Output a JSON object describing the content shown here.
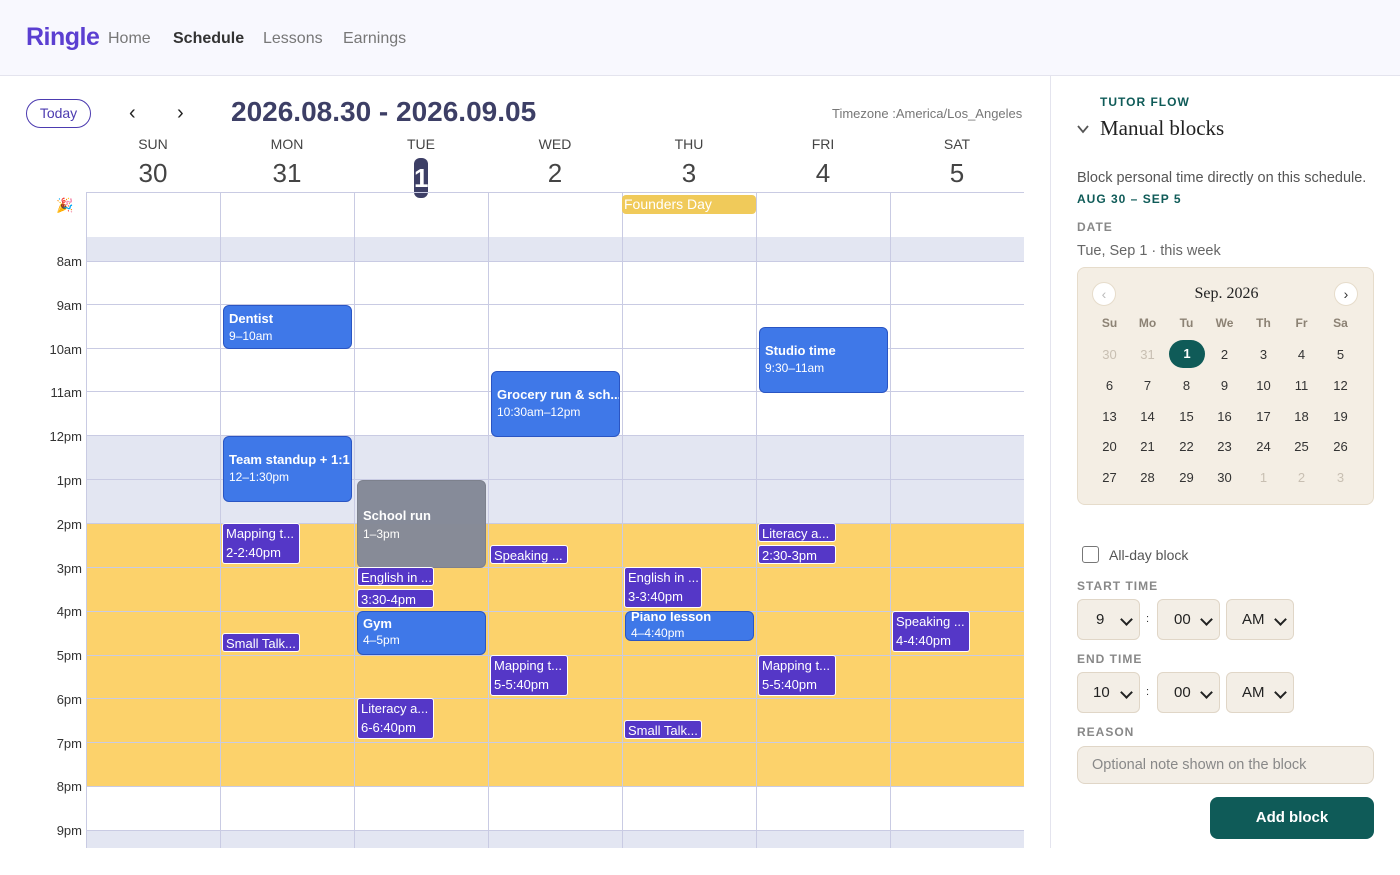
{
  "app": {
    "logo": "Ringle"
  },
  "nav": [
    "Home",
    "Schedule",
    "Lessons",
    "Earnings"
  ],
  "toolbar": {
    "today": "Today",
    "prev": "‹",
    "next": "›",
    "range": "2026.08.30 - 2026.09.05",
    "timezone": "Timezone :America/Los_Angeles"
  },
  "days": [
    {
      "name": "SUN",
      "date": "30"
    },
    {
      "name": "MON",
      "date": "31"
    },
    {
      "name": "TUE",
      "date": "1",
      "selected": true
    },
    {
      "name": "WED",
      "date": "2"
    },
    {
      "name": "THU",
      "date": "3"
    },
    {
      "name": "FRI",
      "date": "4"
    },
    {
      "name": "SAT",
      "date": "5"
    }
  ],
  "all_day_icon": "🎉",
  "all_day_event": "Founders Day",
  "hours": [
    "8am",
    "9am",
    "10am",
    "11am",
    "12pm",
    "1pm",
    "2pm",
    "3pm",
    "4pm",
    "5pm",
    "6pm",
    "7pm",
    "8pm",
    "9pm"
  ],
  "events": [
    {
      "title": "Dentist",
      "time": "9–10am"
    },
    {
      "title": "Team standup + 1:1",
      "time": "12–1:30pm"
    },
    {
      "title": "Studio time",
      "time": "9:30–11am"
    },
    {
      "title": "Grocery run & sch...",
      "time": "10:30am–12pm"
    },
    {
      "title": "School run",
      "time": "1–3pm"
    },
    {
      "title": "Gym",
      "time": "4–5pm"
    },
    {
      "title": "Piano lesson",
      "time": "4–4:40pm"
    }
  ],
  "slots": [
    {
      "title": "Mapping t...",
      "time": "2-2:40pm"
    },
    {
      "title": "Small Talk..."
    },
    {
      "title": "English in ...",
      "time": "3:30-4pm"
    },
    {
      "title": "Literacy a...",
      "time": "6-6:40pm"
    },
    {
      "title": "Speaking ..."
    },
    {
      "title": "Mapping t...",
      "time": "5-5:40pm"
    },
    {
      "title": "English in ...",
      "time": "3-3:40pm"
    },
    {
      "title": "Small Talk..."
    },
    {
      "title": "Literacy a...",
      "time": "2:30-3pm"
    },
    {
      "title": "Mapping t...",
      "time": "5-5:40pm"
    },
    {
      "title": "Speaking ...",
      "time": "4-4:40pm"
    }
  ],
  "colors": {
    "accent": "#5b3fd1",
    "teal": "#0f5b58",
    "event_blue": "#3f78e8",
    "slot_purple": "#5537c7",
    "open_hours": "#fcd26b",
    "blocked": "#e3e6f2",
    "holiday": "#f0ca5a"
  },
  "sidebar": {
    "flow_label": "TUTOR FLOW",
    "chevron_icon": "chevron-down-icon",
    "title": "Manual blocks",
    "description": "Block personal time directly on this schedule.",
    "range": "AUG 30 – SEP 5",
    "date_label": "DATE",
    "date_value": "Tue, Sep 1 · this week",
    "calendar": {
      "month": "Sep. 2026",
      "prev": "‹",
      "next": "›",
      "weekdays": [
        "Su",
        "Mo",
        "Tu",
        "We",
        "Th",
        "Fr",
        "Sa"
      ],
      "weeks": [
        [
          "30",
          "31",
          "1",
          "2",
          "3",
          "4",
          "5"
        ],
        [
          "6",
          "7",
          "8",
          "9",
          "10",
          "11",
          "12"
        ],
        [
          "13",
          "14",
          "15",
          "16",
          "17",
          "18",
          "19"
        ],
        [
          "20",
          "21",
          "22",
          "23",
          "24",
          "25",
          "26"
        ],
        [
          "27",
          "28",
          "29",
          "30",
          "1",
          "2",
          "3"
        ]
      ],
      "selected": "1"
    },
    "all_day_label": "All-day block",
    "start_label": "START TIME",
    "start": {
      "hour": "9",
      "minute": "00",
      "ampm": "AM"
    },
    "end_label": "END TIME",
    "end": {
      "hour": "10",
      "minute": "00",
      "ampm": "AM"
    },
    "colon": ":",
    "reason_label": "REASON",
    "reason_placeholder": "Optional note shown on the block",
    "add_button": "Add block"
  }
}
